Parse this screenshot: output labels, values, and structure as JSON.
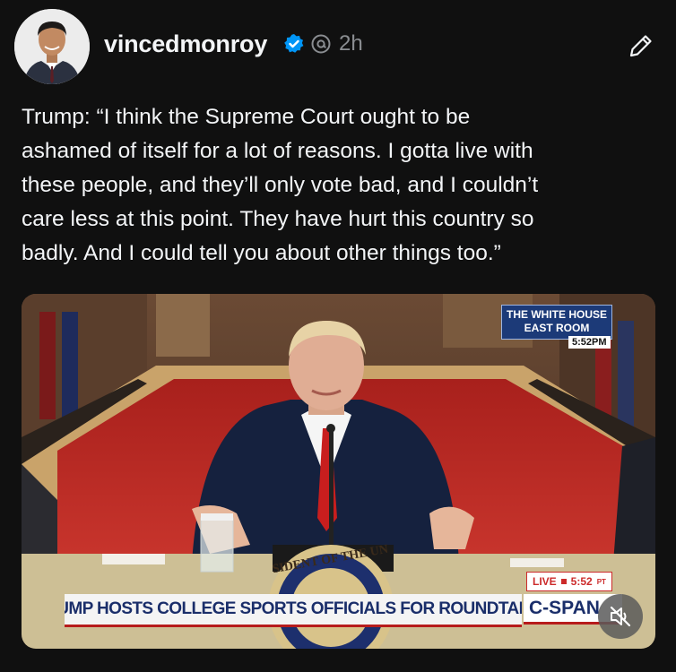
{
  "post": {
    "username": "vincedmonroy",
    "time": "2h",
    "text": "Trump: “I think the Supreme Court ought to be\nashamed of itself for a lot of reasons. I gotta live with\nthese people, and they’ll only vote bad, and I couldn’t\ncare less at this point. They have hurt this country so\nbadly. And I could tell you about other things too.”"
  },
  "media": {
    "location_line1": "THE WHITE HOUSE",
    "location_line2": "EAST ROOM",
    "location_time": "5:52PM",
    "live_label": "LIVE",
    "live_time": "5:52",
    "live_tz": "PT",
    "chyron": "TRUMP HOSTS COLLEGE SPORTS OFFICIALS FOR ROUNDTABLE",
    "network": "C-SPAN",
    "seal_text": "SIDENT OF THE UN"
  },
  "icons": {
    "verified": "verified-badge-icon",
    "threads": "threads-logo-icon",
    "edit": "pencil-icon",
    "mute": "speaker-muted-icon"
  },
  "colors": {
    "background": "#101010",
    "text": "#f3f5f7",
    "muted": "#8a8d91",
    "verified": "#0095f6"
  }
}
